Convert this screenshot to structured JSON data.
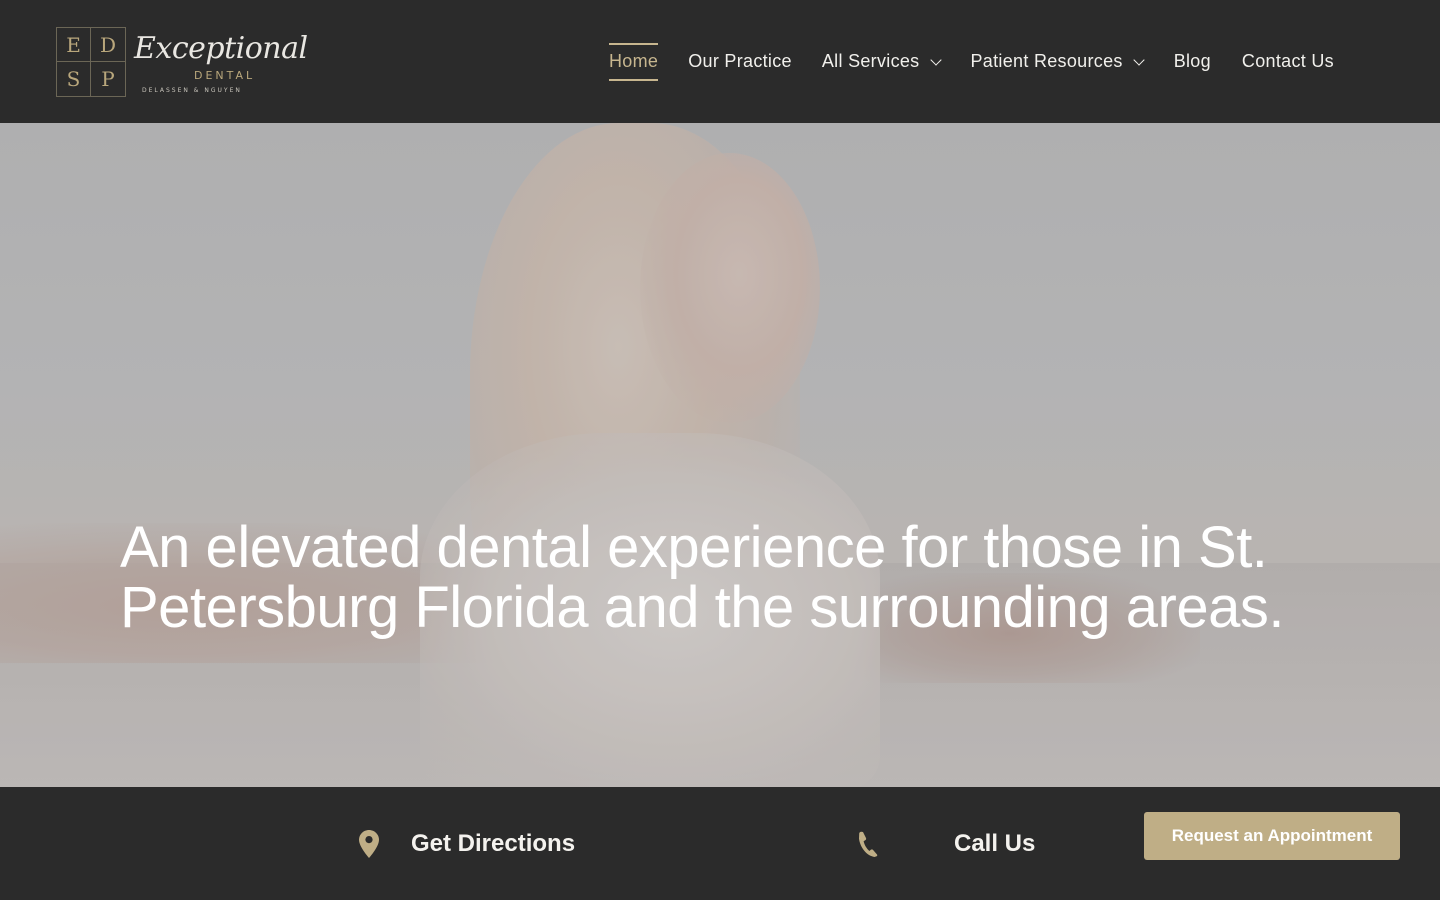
{
  "brand": {
    "monogram": [
      "E",
      "D",
      "S",
      "P"
    ],
    "script_name": "Exceptional",
    "sub_name": "DENTAL",
    "doctors": "DELASSEN & NGUYEN"
  },
  "nav": {
    "items": [
      {
        "label": "Home",
        "active": true,
        "has_dropdown": false
      },
      {
        "label": "Our Practice",
        "active": false,
        "has_dropdown": false
      },
      {
        "label": "All Services",
        "active": false,
        "has_dropdown": true
      },
      {
        "label": "Patient Resources",
        "active": false,
        "has_dropdown": true
      },
      {
        "label": "Blog",
        "active": false,
        "has_dropdown": false
      },
      {
        "label": "Contact Us",
        "active": false,
        "has_dropdown": false
      }
    ]
  },
  "hero": {
    "heading": "An elevated dental experience for those in St. Petersburg Florida and the surrounding areas."
  },
  "actions": {
    "directions_label": "Get Directions",
    "directions_icon": "map-pin-icon",
    "call_label": "Call Us",
    "call_icon": "phone-icon",
    "appointment_label": "Request an Appointment"
  },
  "colors": {
    "header_bg": "#2b2b2b",
    "accent_gold": "#bfae86",
    "nav_active": "#c7b68f",
    "text_light": "#f1f0ec"
  }
}
